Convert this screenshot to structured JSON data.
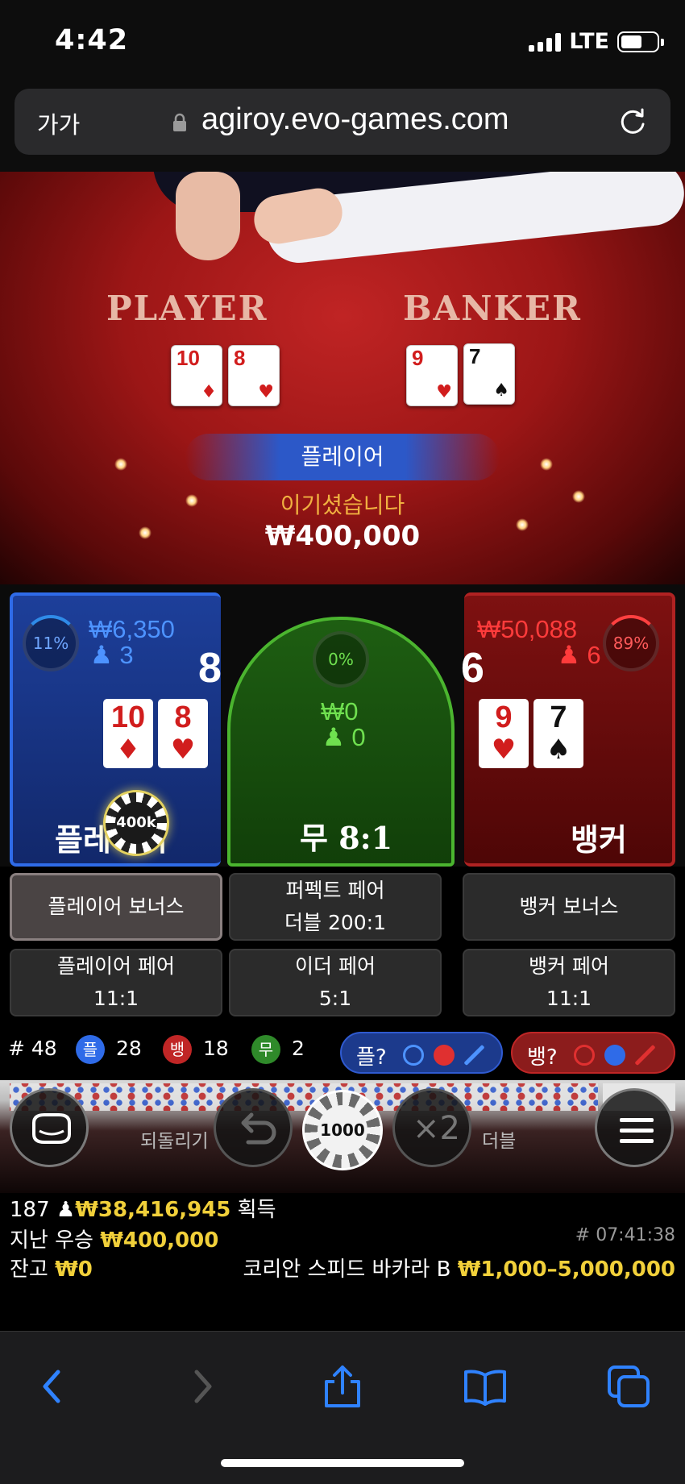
{
  "status_bar": {
    "time": "4:42",
    "network": "LTE"
  },
  "browser": {
    "text_size_button": "가가",
    "url": "agiroy.evo-games.com"
  },
  "video": {
    "player_label": "PLAYER",
    "banker_label": "BANKER",
    "player_cards": [
      {
        "rank": "10",
        "suit": "♦",
        "color": "red"
      },
      {
        "rank": "8",
        "suit": "♥",
        "color": "red"
      }
    ],
    "banker_cards": [
      {
        "rank": "9",
        "suit": "♥",
        "color": "red"
      },
      {
        "rank": "7",
        "suit": "♠",
        "color": "black"
      }
    ],
    "winner_banner": "플레이어",
    "win_message": "이기셨습니다",
    "win_amount": "₩400,000"
  },
  "board": {
    "player": {
      "percent": "11%",
      "amount": "₩6,350",
      "players": "3",
      "score": "8",
      "label": "플레이어",
      "chip": "400k",
      "cards": [
        {
          "rank": "10",
          "suit": "♦"
        },
        {
          "rank": "8",
          "suit": "♥"
        }
      ]
    },
    "tie": {
      "percent": "0%",
      "amount": "₩0",
      "players": "0",
      "label": "무 8:1"
    },
    "banker": {
      "percent": "89%",
      "amount": "₩50,088",
      "players": "6",
      "score": "6",
      "label": "뱅커",
      "cards": [
        {
          "rank": "9",
          "suit": "♥"
        },
        {
          "rank": "7",
          "suit": "♠"
        }
      ]
    }
  },
  "side_bets": [
    {
      "line1": "플레이어 보너스",
      "line2": ""
    },
    {
      "line1": "퍼펙트 페어",
      "line2": "더블 200:1"
    },
    {
      "line1": "뱅커 보너스",
      "line2": ""
    },
    {
      "line1": "플레이어 페어",
      "line2": "11:1"
    },
    {
      "line1": "이더 페어",
      "line2": "5:1"
    },
    {
      "line1": "뱅커 페어",
      "line2": "11:1"
    }
  ],
  "summary": {
    "rounds": "# 48",
    "player_badge": "플",
    "player_count": "28",
    "banker_badge": "뱅",
    "banker_count": "18",
    "tie_badge": "무",
    "tie_count": "2",
    "player_predict": "플?",
    "banker_predict": "뱅?"
  },
  "controls": {
    "undo_label": "되돌리기",
    "chip_value": "1000",
    "double_symbol": "×2",
    "double_label": "더블"
  },
  "info": {
    "online_count": "187",
    "total_won": "₩38,416,945",
    "won_label": "획득",
    "last_win_label": "지난 우승",
    "last_win_amount": "₩400,000",
    "round_id": "# 07:41:38",
    "balance_label": "잔고",
    "balance": "₩0",
    "table_name": "코리안 스피드 바카라 B",
    "limits": "₩1,000–5,000,000"
  },
  "colors": {
    "player": "#2f6be8",
    "banker": "#c02626",
    "tie": "#4bb52f",
    "gold": "#f1d03a"
  }
}
